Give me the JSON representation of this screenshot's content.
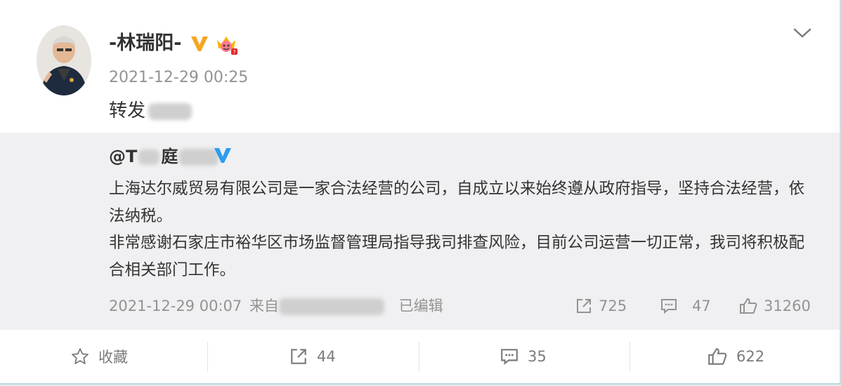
{
  "post": {
    "author": "-林瑞阳-",
    "timestamp": "2021-12-29 00:25",
    "text": "转发"
  },
  "repost": {
    "author_prefix": "@T",
    "author_mid": "庭",
    "paragraph1": "上海达尔威贸易有限公司是一家合法经营的公司，自成立以来始终遵从政府指导，坚持合法经营，依法纳税。",
    "paragraph2": "非常感谢石家庄市裕华区市场监督管理局指导我司排查风险，目前公司运营一切正常，我司将积极配合相关部门工作。",
    "timestamp": "2021-12-29 00:07",
    "source_prefix": "来自",
    "edited": "已编辑",
    "reposts": "725",
    "comments": "47",
    "likes": "31260"
  },
  "actions": {
    "favorite": "收藏",
    "reposts": "44",
    "comments": "35",
    "likes": "622"
  },
  "colors": {
    "verified_gold": "#f5a623",
    "verified_blue": "#2d9cf0",
    "text": "#333333",
    "muted": "#939393",
    "repost_bg": "#f0f0f2"
  }
}
